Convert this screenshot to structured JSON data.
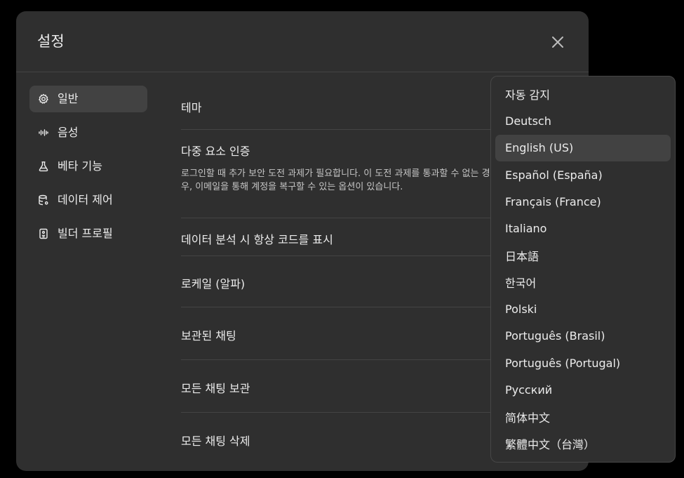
{
  "modal": {
    "title": "설정"
  },
  "sidebar": {
    "items": [
      {
        "label": "일반",
        "icon": "gear-icon",
        "active": true
      },
      {
        "label": "음성",
        "icon": "waveform-icon",
        "active": false
      },
      {
        "label": "베타 기능",
        "icon": "flask-icon",
        "active": false
      },
      {
        "label": "데이터 제어",
        "icon": "database-icon",
        "active": false
      },
      {
        "label": "빌더 프로필",
        "icon": "id-card-icon",
        "active": false
      }
    ]
  },
  "settings": {
    "theme": {
      "label": "테마"
    },
    "mfa": {
      "label": "다중 요소 인증",
      "desc": "로그인할 때 추가 보안 도전 과제가 필요합니다. 이 도전 과제를 통과할 수 없는 경우, 이메일을 통해 계정을 복구할 수 있는 옵션이 있습니다."
    },
    "show_code": {
      "label": "데이터 분석 시 항상 코드를 표시"
    },
    "locale": {
      "label": "로케일 (알파)"
    },
    "archived": {
      "label": "보관된 채팅"
    },
    "archive_all": {
      "label": "모든 채팅 보관"
    },
    "delete_all": {
      "label": "모든 채팅 삭제"
    }
  },
  "locale_dropdown": {
    "selected": "English (US)",
    "options": [
      "자동 감지",
      "Deutsch",
      "English (US)",
      "Español (España)",
      "Français (France)",
      "Italiano",
      "日本語",
      "한국어",
      "Polski",
      "Português (Brasil)",
      "Português (Portugal)",
      "Русский",
      "简体中文",
      "繁體中文（台灣）"
    ]
  }
}
